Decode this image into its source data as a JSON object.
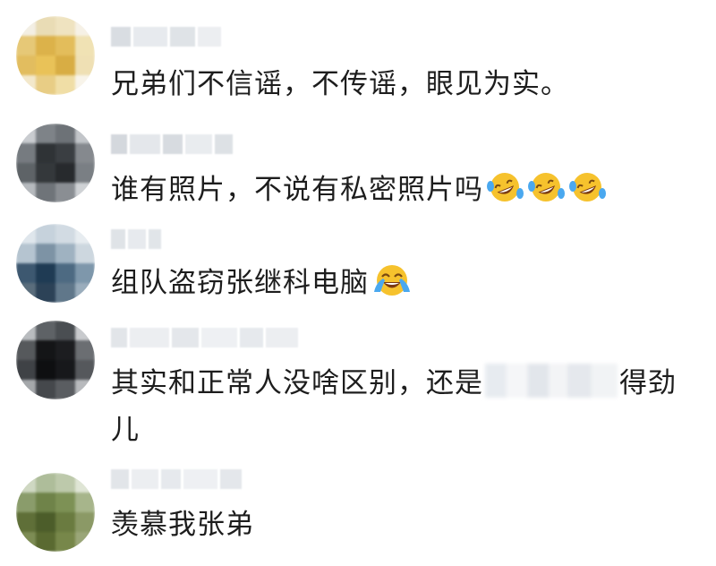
{
  "comments": [
    {
      "text": "兄弟们不信谣，不传谣，眼见为实。"
    },
    {
      "text": "谁有照片，不说有私密照片吗",
      "emoji": "rolling-laughing-emoji"
    },
    {
      "text": "组队盗窃张继科电脑",
      "emoji": "crying-laughing-emoji"
    },
    {
      "text_start": "其实和正常人没啥区别，还是",
      "text_end": "得劲",
      "text_line2": "儿"
    },
    {
      "text": "羡慕我张弟"
    }
  ],
  "colors": {
    "text": "#1d1d1d",
    "emoji_face": "#f6c22d",
    "emoji_tear": "#4aa8ef"
  }
}
